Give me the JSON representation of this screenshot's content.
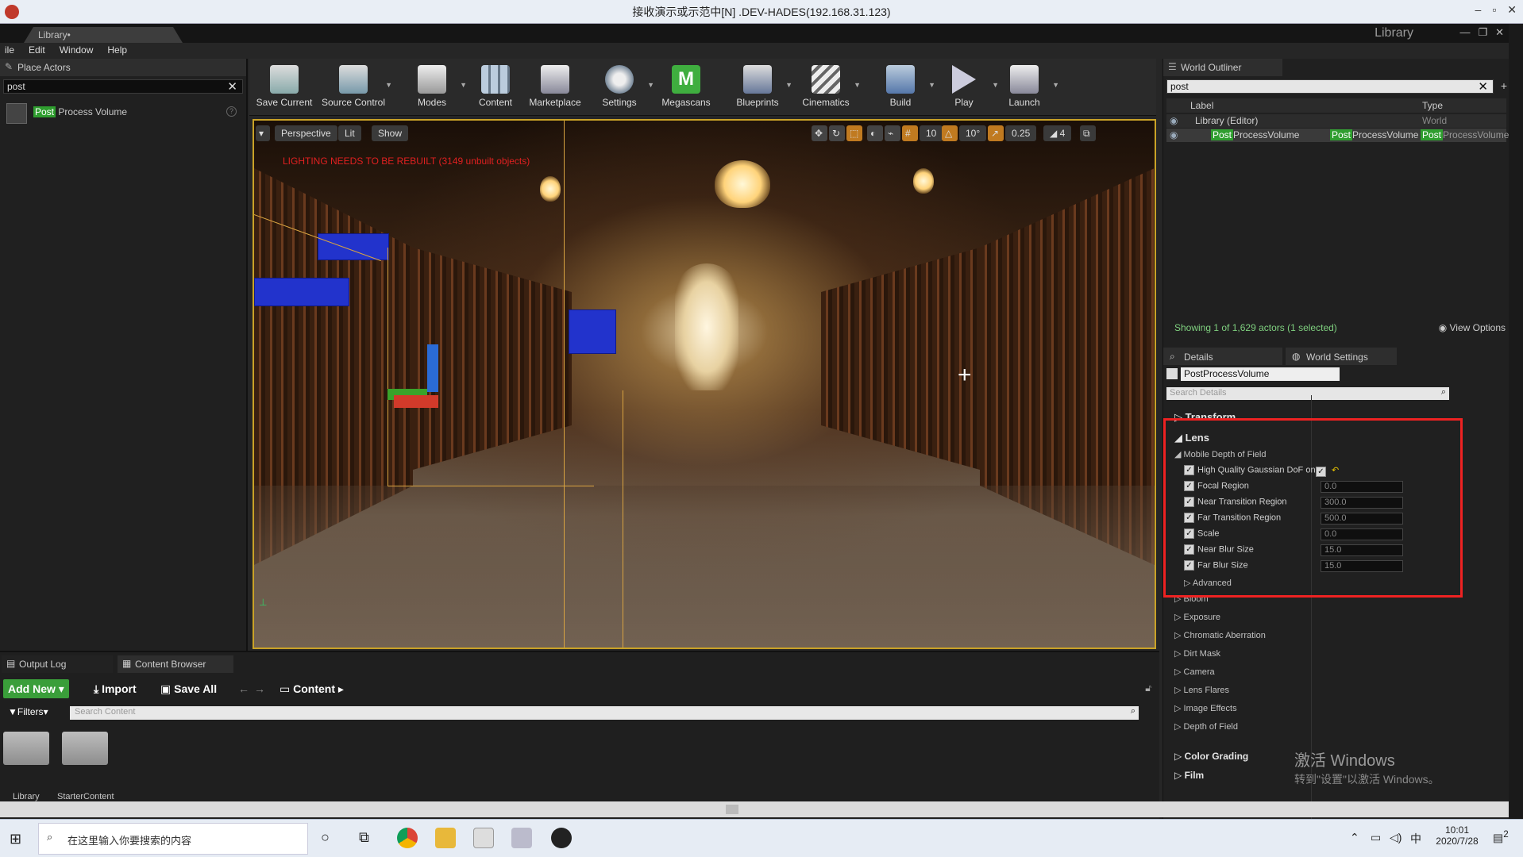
{
  "remote_title": "接收演示或示范中[N] .DEV-HADES(192.168.31.123)",
  "editor": {
    "doc_tab": "Library•",
    "project_label": "Library",
    "menu": [
      "ile",
      "Edit",
      "Window",
      "Help"
    ]
  },
  "place_actors": {
    "tab_label": "Place Actors",
    "search_value": "post",
    "result_highlight": "Post",
    "result_rest": " Process Volume"
  },
  "toolbar": [
    {
      "label": "Save Current",
      "icon": "save-icon"
    },
    {
      "label": "Source Control",
      "icon": "source-control-icon"
    },
    {
      "label": "Modes",
      "icon": "modes-icon"
    },
    {
      "label": "Content",
      "icon": "content-icon"
    },
    {
      "label": "Marketplace",
      "icon": "marketplace-icon"
    },
    {
      "label": "Settings",
      "icon": "settings-icon"
    },
    {
      "label": "Megascans",
      "icon": "megascans-icon"
    },
    {
      "label": "Blueprints",
      "icon": "blueprints-icon"
    },
    {
      "label": "Cinematics",
      "icon": "cinematics-icon"
    },
    {
      "label": "Build",
      "icon": "build-icon"
    },
    {
      "label": "Play",
      "icon": "play-icon"
    },
    {
      "label": "Launch",
      "icon": "launch-icon"
    }
  ],
  "viewport": {
    "perspective": "Perspective",
    "lit": "Lit",
    "show": "Show",
    "warning": "LIGHTING NEEDS TO BE REBUILT (3149 unbuilt objects)",
    "grid_snap": "10",
    "rot_snap": "10°",
    "scale_snap": "0.25",
    "cam_speed": "4"
  },
  "outliner": {
    "tab_label": "World Outliner",
    "search_value": "post",
    "col_label": "Label",
    "col_type": "Type",
    "rows": [
      {
        "label": "Library (Editor)",
        "type": "World"
      },
      {
        "label_hl": "Post",
        "label_rest": "ProcessVolume",
        "type_hl": "Post",
        "type_rest": "ProcessVolume",
        "type2_hl": "Post",
        "type2_rest": "ProcessVolume"
      }
    ],
    "status": "Showing 1 of 1,629 actors (1 selected)",
    "view_options": "View Options"
  },
  "details": {
    "tab_details": "Details",
    "tab_world": "World Settings",
    "object_name": "PostProcessVolume",
    "search_placeholder": "Search Details",
    "transform": "Transform",
    "lens": "Lens",
    "mobile_dof": "Mobile Depth of Field",
    "props": [
      {
        "label": "High Quality Gaussian DoF on",
        "value": ""
      },
      {
        "label": "Focal Region",
        "value": "0.0"
      },
      {
        "label": "Near Transition Region",
        "value": "300.0"
      },
      {
        "label": "Far Transition Region",
        "value": "500.0"
      },
      {
        "label": "Scale",
        "value": "0.0"
      },
      {
        "label": "Near Blur Size",
        "value": "15.0"
      },
      {
        "label": "Far Blur Size",
        "value": "15.0"
      }
    ],
    "advanced": "Advanced",
    "sections": [
      "Bloom",
      "Exposure",
      "Chromatic Aberration",
      "Dirt Mask",
      "Camera",
      "Lens Flares",
      "Image Effects",
      "Depth of Field"
    ],
    "color_grading": "Color Grading",
    "film": "Film"
  },
  "bottom": {
    "tab_output": "Output Log",
    "tab_content": "Content Browser",
    "add_new": "Add New",
    "import": "Import",
    "save_all": "Save All",
    "path": "Content",
    "filters": "Filters",
    "search_placeholder": "Search Content",
    "folders": [
      "Library",
      "StarterContent"
    ]
  },
  "watermark": {
    "line1": "激活 Windows",
    "line2": "转到\"设置\"以激活 Windows。"
  },
  "taskbar": {
    "search_placeholder": "在这里输入你要搜索的内容",
    "ime": "中",
    "time": "10:01",
    "date": "2020/7/28",
    "notif_count": "2"
  },
  "colors": {
    "highlight": "#2f9e2f",
    "selection_frame": "#c9a227",
    "annotation": "#ee2222",
    "status_green": "#7fd07f"
  }
}
